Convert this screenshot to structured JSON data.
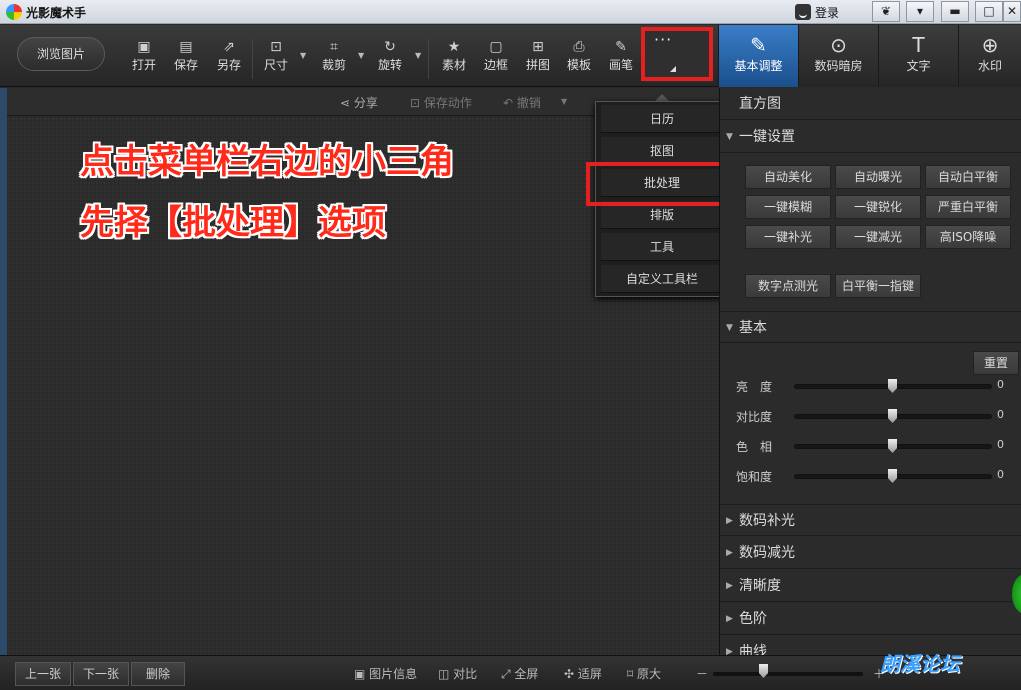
{
  "app": {
    "title": "光影魔术手",
    "login_label": "登录"
  },
  "window_controls": [
    {
      "name": "skin-button",
      "glyph": "❦"
    },
    {
      "name": "menu-button",
      "glyph": "▾"
    },
    {
      "name": "minimize-button",
      "glyph": "▬"
    },
    {
      "name": "maximize-button",
      "glyph": "□"
    },
    {
      "name": "close-button",
      "glyph": "✕"
    }
  ],
  "toolbar": {
    "browse_label": "浏览图片",
    "tools": [
      {
        "label": "打开",
        "icon": "▣"
      },
      {
        "label": "保存",
        "icon": "▤"
      },
      {
        "label": "另存",
        "icon": "⇗"
      },
      {
        "label": "尺寸",
        "icon": "⊡"
      },
      {
        "label": "裁剪",
        "icon": "⌗"
      },
      {
        "label": "旋转",
        "icon": "↻"
      },
      {
        "label": "素材",
        "icon": "★"
      },
      {
        "label": "边框",
        "icon": "▢"
      },
      {
        "label": "拼图",
        "icon": "⊞"
      },
      {
        "label": "模板",
        "icon": "⎙"
      },
      {
        "label": "画笔",
        "icon": "✎"
      }
    ],
    "more_glyph": "···",
    "right_tabs": [
      {
        "label": "基本调整",
        "icon": "✎",
        "active": true
      },
      {
        "label": "数码暗房",
        "icon": "⊙",
        "active": false
      },
      {
        "label": "文字",
        "icon": "T",
        "active": false
      },
      {
        "label": "水印",
        "icon": "⊕",
        "active": false
      }
    ]
  },
  "actionbar": {
    "share": "分享",
    "save_action": "保存动作",
    "undo": "撤销"
  },
  "annotation": {
    "line1": "点击菜单栏右边的小三角",
    "line2": "先择【批处理】选项"
  },
  "dropdown": {
    "items": [
      "日历",
      "抠图",
      "批处理",
      "排版",
      "工具",
      "自定义工具栏"
    ],
    "highlighted": "批处理"
  },
  "right_panel": {
    "histogram": "直方图",
    "oneclick": "一键设置",
    "oneclick_buttons": [
      "自动美化",
      "自动曝光",
      "自动白平衡",
      "一键模糊",
      "一键锐化",
      "严重白平衡",
      "一键补光",
      "一键减光",
      "高ISO降噪"
    ],
    "extra_buttons": [
      "数字点测光",
      "白平衡一指键"
    ],
    "basic": "基本",
    "reset": "重置",
    "sliders": [
      {
        "label": "亮　度",
        "value": 0
      },
      {
        "label": "对比度",
        "value": 0
      },
      {
        "label": "色　相",
        "value": 0
      },
      {
        "label": "饱和度",
        "value": 0
      }
    ],
    "sections": [
      "数码补光",
      "数码减光",
      "清晰度",
      "色阶",
      "曲线"
    ]
  },
  "bottombar": {
    "prev": "上一张",
    "next": "下一张",
    "delete": "删除",
    "info": "图片信息",
    "compare": "对比",
    "fullscreen": "全屏",
    "fit": "适屏",
    "original": "原大",
    "minus": "－",
    "plus": "＋"
  },
  "watermark": "朗溪论坛",
  "colors": {
    "highlight": "#e42020",
    "active_tab": "#2a66ad",
    "annotation": "#ff2a1a"
  }
}
